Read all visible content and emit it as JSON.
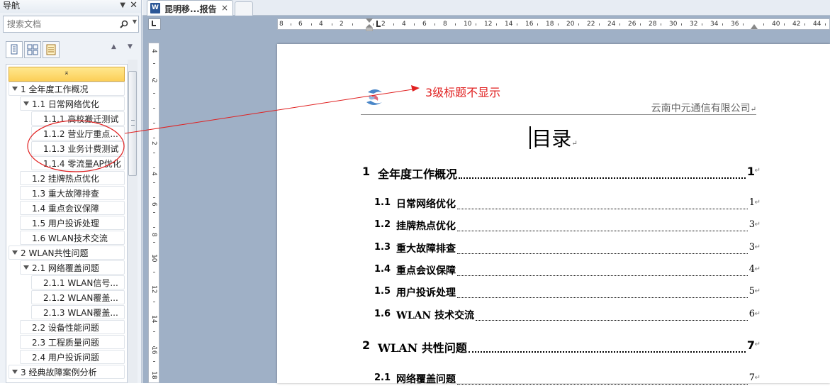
{
  "nav": {
    "title": "导航",
    "dropdown_icon": "triangle-down-icon",
    "close_icon": "close-icon",
    "search": {
      "placeholder": "搜索文档",
      "icon": "search-icon"
    },
    "view_tabs": [
      "headings-view-icon",
      "pages-view-icon",
      "results-view-icon"
    ],
    "tree": [
      {
        "label": "1 全年度工作概况",
        "level": 1,
        "expanded": true
      },
      {
        "label": "1.1 日常网络优化",
        "level": 2,
        "expanded": true
      },
      {
        "label": "1.1.1 高校搬迁测试",
        "level": 3
      },
      {
        "label": "1.1.2 营业厅重点...",
        "level": 3
      },
      {
        "label": "1.1.3 业务计费测试",
        "level": 3
      },
      {
        "label": "1.1.4 零流量AP优化",
        "level": 3
      },
      {
        "label": "1.2 挂牌热点优化",
        "level": 2
      },
      {
        "label": "1.3 重大故障排查",
        "level": 2
      },
      {
        "label": "1.4 重点会议保障",
        "level": 2
      },
      {
        "label": "1.5 用户投诉处理",
        "level": 2
      },
      {
        "label": "1.6 WLAN技术交流",
        "level": 2
      },
      {
        "label": "2 WLAN共性问题",
        "level": 1,
        "expanded": true
      },
      {
        "label": "2.1 网络覆盖问题",
        "level": 2,
        "expanded": true
      },
      {
        "label": "2.1.1 WLAN信号...",
        "level": 3
      },
      {
        "label": "2.1.2 WLAN覆盖...",
        "level": 3
      },
      {
        "label": "2.1.3 WLAN覆盖...",
        "level": 3
      },
      {
        "label": "2.2 设备性能问题",
        "level": 2
      },
      {
        "label": "2.3 工程质量问题",
        "level": 2
      },
      {
        "label": "2.4 用户投诉问题",
        "level": 2
      },
      {
        "label": "3 经典故障案例分析",
        "level": 1,
        "expanded": true
      }
    ]
  },
  "doc_tab": {
    "label": "昆明移...报告",
    "close": "×",
    "app_icon": "W"
  },
  "ruler": {
    "h_ticks": [
      "8",
      "6",
      "4",
      "2",
      "2",
      "4",
      "6",
      "8",
      "10",
      "12",
      "14",
      "16",
      "18",
      "20",
      "22",
      "24",
      "26",
      "28",
      "30",
      "32",
      "34",
      "36",
      "40",
      "42",
      "44"
    ],
    "v_ticks": [
      "4",
      "2",
      "2",
      "4",
      "6",
      "8",
      "10",
      "12",
      "14",
      "16",
      "18"
    ]
  },
  "page": {
    "header_company": "云南中元通信有限公司",
    "para_mark": "↵",
    "toc_title": "目录",
    "toc": [
      {
        "num": "1",
        "text": "全年度工作概况",
        "page": "1",
        "level": 1
      },
      {
        "num": "1.1",
        "text": "日常网络优化",
        "page": "1",
        "level": 2
      },
      {
        "num": "1.2",
        "text": "挂牌热点优化",
        "page": "3",
        "level": 2
      },
      {
        "num": "1.3",
        "text": "重大故障排查",
        "page": "3",
        "level": 2
      },
      {
        "num": "1.4",
        "text": "重点会议保障",
        "page": "4",
        "level": 2
      },
      {
        "num": "1.5",
        "text": "用户投诉处理",
        "page": "5",
        "level": 2
      },
      {
        "num": "1.6",
        "text": "WLAN 技术交流",
        "page": "6",
        "level": 2
      },
      {
        "num": "2",
        "text": "WLAN 共性问题",
        "page": "7",
        "level": 1
      },
      {
        "num": "2.1",
        "text": "网络覆盖问题",
        "page": "7",
        "level": 2
      }
    ]
  },
  "annotation": {
    "text": "3级标题不显示",
    "color": "#e02020"
  }
}
